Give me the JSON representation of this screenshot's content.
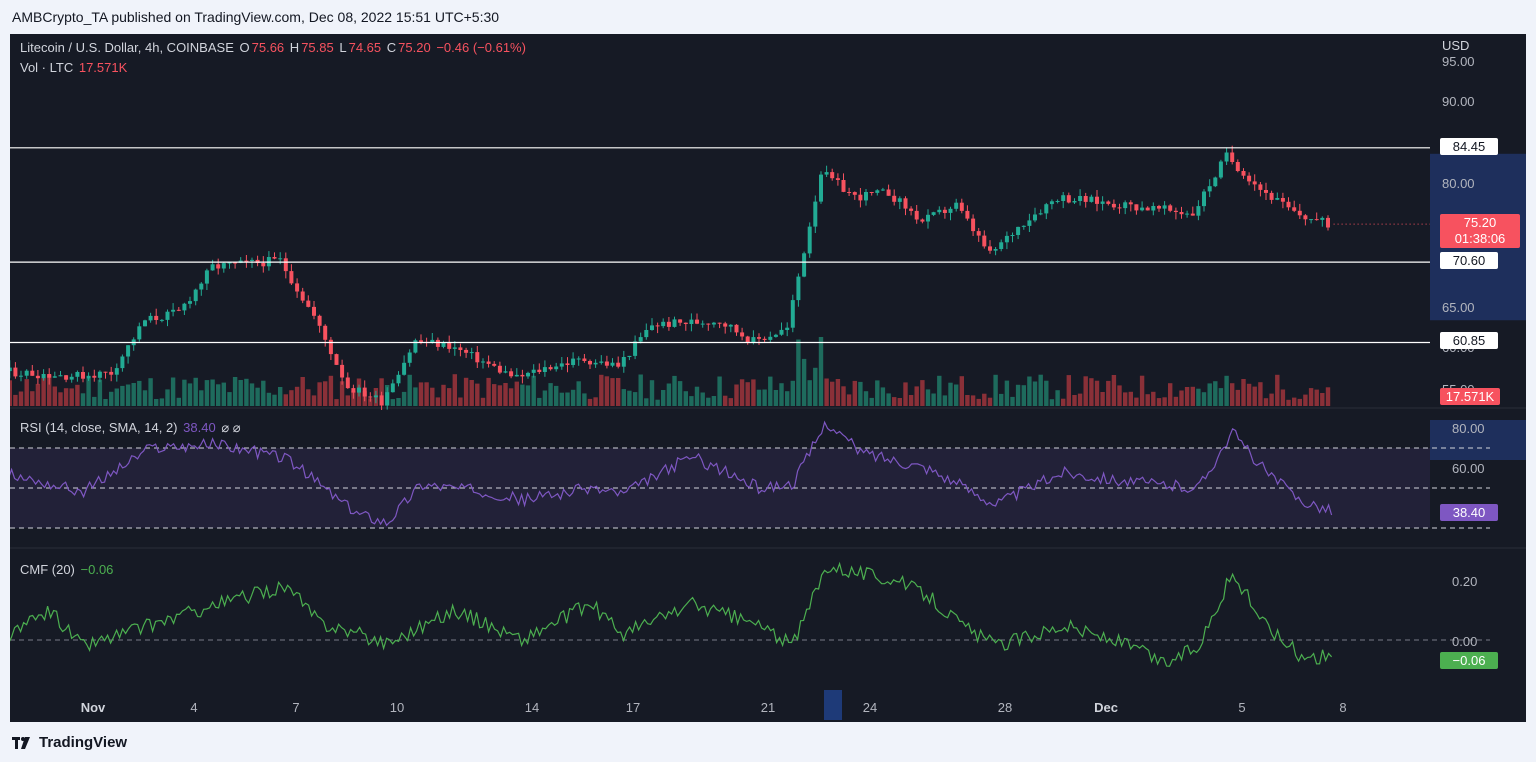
{
  "header": {
    "publisher": "AMBCrypto_TA published on TradingView.com, Dec 08, 2022 15:51 UTC+5:30"
  },
  "footer": {
    "brand": "TradingView"
  },
  "main_legend": {
    "symbol": "Litecoin / U.S. Dollar, 4h, COINBASE",
    "open_label": "O",
    "open": "75.66",
    "high_label": "H",
    "high": "75.85",
    "low_label": "L",
    "low": "74.65",
    "close_label": "C",
    "close": "75.20",
    "change": "−0.46 (−0.61%)"
  },
  "vol_legend": {
    "label": "Vol · LTC",
    "value": "17.571K"
  },
  "rsi_legend": {
    "label": "RSI (14, close, SMA, 14, 2)",
    "value": "38.40",
    "icons": "⌀ ⌀"
  },
  "cmf_legend": {
    "label": "CMF (20)",
    "value": "−0.06"
  },
  "price_axis": {
    "currency": "USD",
    "ticks": [
      "95.00",
      "90.00",
      "80.00",
      "65.00",
      "60.00",
      "55.00"
    ],
    "levels": [
      "84.45",
      "70.60",
      "60.85"
    ],
    "last_price": "75.20",
    "countdown": "01:38:06",
    "volume_tag": "17.571K"
  },
  "rsi_axis": {
    "ticks": [
      "80.00",
      "60.00"
    ],
    "current": "38.40"
  },
  "cmf_axis": {
    "ticks": [
      "0.20",
      "0.00"
    ],
    "current": "−0.06"
  },
  "time_axis": {
    "labels": [
      {
        "text": "Nov",
        "bold": true
      },
      {
        "text": "4",
        "bold": false
      },
      {
        "text": "7",
        "bold": false
      },
      {
        "text": "10",
        "bold": false
      },
      {
        "text": "14",
        "bold": false
      },
      {
        "text": "17",
        "bold": false
      },
      {
        "text": "21",
        "bold": false
      },
      {
        "text": "24",
        "bold": false
      },
      {
        "text": "28",
        "bold": false
      },
      {
        "text": "Dec",
        "bold": true
      },
      {
        "text": "5",
        "bold": false
      },
      {
        "text": "8",
        "bold": false
      }
    ]
  },
  "colors": {
    "background": "#161a25",
    "up": "#22ab94",
    "down": "#f7525f",
    "rsi": "#7e57c2",
    "cmf": "#4caf50",
    "level_line": "#ffffff"
  },
  "chart_data": [
    {
      "type": "candlestick",
      "title": "Litecoin / U.S. Dollar, 4h, COINBASE",
      "ylabel": "USD",
      "ylim": [
        54,
        96
      ],
      "horizontal_levels": [
        84.45,
        70.6,
        60.85
      ],
      "anchors": [
        {
          "date": "Oct 29",
          "price": 57.5
        },
        {
          "date": "Nov 01",
          "price": 56.8
        },
        {
          "date": "Nov 02",
          "price": 57.2
        },
        {
          "date": "Nov 03",
          "price": 63.5
        },
        {
          "date": "Nov 04",
          "price": 64.5
        },
        {
          "date": "Nov 05",
          "price": 70.0
        },
        {
          "date": "Nov 07",
          "price": 70.8
        },
        {
          "date": "Nov 08",
          "price": 64.0
        },
        {
          "date": "Nov 09",
          "price": 55.5
        },
        {
          "date": "Nov 10",
          "price": 53.8
        },
        {
          "date": "Nov 11",
          "price": 61.0
        },
        {
          "date": "Nov 12",
          "price": 60.5
        },
        {
          "date": "Nov 13",
          "price": 58.5
        },
        {
          "date": "Nov 14",
          "price": 56.5
        },
        {
          "date": "Nov 15",
          "price": 58.0
        },
        {
          "date": "Nov 16",
          "price": 58.8
        },
        {
          "date": "Nov 17",
          "price": 58.0
        },
        {
          "date": "Nov 18",
          "price": 63.0
        },
        {
          "date": "Nov 20",
          "price": 63.5
        },
        {
          "date": "Nov 21",
          "price": 61.0
        },
        {
          "date": "Nov 22",
          "price": 62.5
        },
        {
          "date": "Nov 23",
          "price": 81.5
        },
        {
          "date": "Nov 24",
          "price": 78.5
        },
        {
          "date": "Nov 25",
          "price": 79.0
        },
        {
          "date": "Nov 26",
          "price": 75.5
        },
        {
          "date": "Nov 27",
          "price": 77.5
        },
        {
          "date": "Nov 28",
          "price": 71.5
        },
        {
          "date": "Nov 29",
          "price": 75.5
        },
        {
          "date": "Nov 30",
          "price": 78.5
        },
        {
          "date": "Dec 02",
          "price": 77.5
        },
        {
          "date": "Dec 04",
          "price": 76.5
        },
        {
          "date": "Dec 05",
          "price": 83.5
        },
        {
          "date": "Dec 06",
          "price": 79.5
        },
        {
          "date": "Dec 07",
          "price": 76.5
        },
        {
          "date": "Dec 08",
          "price": 75.2
        }
      ],
      "last": {
        "open": 75.66,
        "high": 75.85,
        "low": 74.65,
        "close": 75.2
      }
    },
    {
      "type": "bar",
      "title": "Vol · LTC",
      "last_value": "17.571K"
    },
    {
      "type": "line",
      "title": "RSI (14, close, SMA, 14, 2)",
      "ylim": [
        20,
        90
      ],
      "bands": [
        70,
        50,
        30
      ],
      "anchors": [
        {
          "date": "Oct 29",
          "value": 60
        },
        {
          "date": "Nov 01",
          "value": 48
        },
        {
          "date": "Nov 03",
          "value": 70
        },
        {
          "date": "Nov 05",
          "value": 72
        },
        {
          "date": "Nov 07",
          "value": 65
        },
        {
          "date": "Nov 08",
          "value": 52
        },
        {
          "date": "Nov 09",
          "value": 38
        },
        {
          "date": "Nov 10",
          "value": 33
        },
        {
          "date": "Nov 11",
          "value": 52
        },
        {
          "date": "Nov 13",
          "value": 48
        },
        {
          "date": "Nov 14",
          "value": 44
        },
        {
          "date": "Nov 16",
          "value": 50
        },
        {
          "date": "Nov 17",
          "value": 47
        },
        {
          "date": "Nov 19",
          "value": 66
        },
        {
          "date": "Nov 21",
          "value": 50
        },
        {
          "date": "Nov 22",
          "value": 52
        },
        {
          "date": "Nov 23",
          "value": 83
        },
        {
          "date": "Nov 24",
          "value": 68
        },
        {
          "date": "Nov 26",
          "value": 60
        },
        {
          "date": "Nov 28",
          "value": 42
        },
        {
          "date": "Nov 30",
          "value": 58
        },
        {
          "date": "Dec 02",
          "value": 53
        },
        {
          "date": "Dec 04",
          "value": 50
        },
        {
          "date": "Dec 05",
          "value": 78
        },
        {
          "date": "Dec 06",
          "value": 58
        },
        {
          "date": "Dec 07",
          "value": 44
        },
        {
          "date": "Dec 08",
          "value": 38.4
        }
      ]
    },
    {
      "type": "line",
      "title": "CMF (20)",
      "ylim": [
        -0.15,
        0.3
      ],
      "zero_line": 0,
      "anchors": [
        {
          "date": "Oct 29",
          "value": -0.05
        },
        {
          "date": "Oct 31",
          "value": 0.1
        },
        {
          "date": "Nov 01",
          "value": -0.02
        },
        {
          "date": "Nov 03",
          "value": 0.05
        },
        {
          "date": "Nov 05",
          "value": 0.12
        },
        {
          "date": "Nov 07",
          "value": 0.18
        },
        {
          "date": "Nov 08",
          "value": 0.06
        },
        {
          "date": "Nov 10",
          "value": -0.01
        },
        {
          "date": "Nov 12",
          "value": 0.1
        },
        {
          "date": "Nov 14",
          "value": 0.0
        },
        {
          "date": "Nov 16",
          "value": 0.12
        },
        {
          "date": "Nov 17",
          "value": 0.02
        },
        {
          "date": "Nov 19",
          "value": 0.12
        },
        {
          "date": "Nov 21",
          "value": 0.05
        },
        {
          "date": "Nov 22",
          "value": -0.02
        },
        {
          "date": "Nov 23",
          "value": 0.25
        },
        {
          "date": "Nov 25",
          "value": 0.2
        },
        {
          "date": "Nov 26",
          "value": 0.15
        },
        {
          "date": "Nov 27",
          "value": 0.05
        },
        {
          "date": "Nov 28",
          "value": -0.02
        },
        {
          "date": "Nov 30",
          "value": 0.05
        },
        {
          "date": "Dec 02",
          "value": -0.02
        },
        {
          "date": "Dec 03",
          "value": -0.08
        },
        {
          "date": "Dec 04",
          "value": -0.02
        },
        {
          "date": "Dec 05",
          "value": 0.22
        },
        {
          "date": "Dec 06",
          "value": 0.05
        },
        {
          "date": "Dec 07",
          "value": -0.05
        },
        {
          "date": "Dec 08",
          "value": -0.06
        }
      ]
    }
  ]
}
